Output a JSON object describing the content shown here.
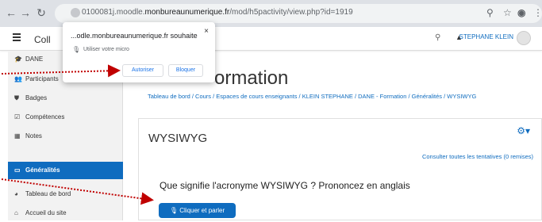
{
  "browser": {
    "url_host_prefix": "0100081j.moodle.",
    "url_host_domain": "monbureaunumerique.fr",
    "url_path": "/mod/h5pactivity/view.php?id=1919",
    "icons": [
      "back-icon",
      "forward-icon",
      "reload-icon",
      "lock-icon",
      "zoom-icon",
      "star-icon",
      "account-icon",
      "menu-dots-icon"
    ]
  },
  "navbar": {
    "brand": "Coll",
    "user_name": "STEPHANE KLEIN"
  },
  "popup": {
    "title": "...odle.monbureaunumerique.fr souhaite",
    "permission_text": "Utiliser votre micro",
    "allow_label": "Autoriser",
    "block_label": "Bloquer",
    "close": "×"
  },
  "sidebar": {
    "items": [
      {
        "label": "DANE",
        "icon": "graduation-cap-icon"
      },
      {
        "label": "Participants",
        "icon": "users-icon"
      },
      {
        "label": "Badges",
        "icon": "shield-icon"
      },
      {
        "label": "Compétences",
        "icon": "checkbox-icon"
      },
      {
        "label": "Notes",
        "icon": "table-icon"
      },
      {
        "label": "Généralités",
        "icon": "folder-icon"
      },
      {
        "label": "Tableau de bord",
        "icon": "dashboard-icon"
      },
      {
        "label": "Accueil du site",
        "icon": "home-icon"
      }
    ]
  },
  "page": {
    "title": "ormation",
    "breadcrumb": "Tableau de bord / Cours / Espaces de cours enseignants / KLEIN STEPHANE / DANE - Formation / Généralités / WYSIWYG"
  },
  "card": {
    "title": "WYSIWYG",
    "attempts_link": "Consulter toutes les tentatives (0 remises)",
    "question": "Que signifie l'acronyme WYSIWYG ? Prononcez en anglais",
    "speak_button": "Cliquer et parler"
  },
  "colors": {
    "accent": "#0f6cbf",
    "arrow": "#c00000"
  }
}
